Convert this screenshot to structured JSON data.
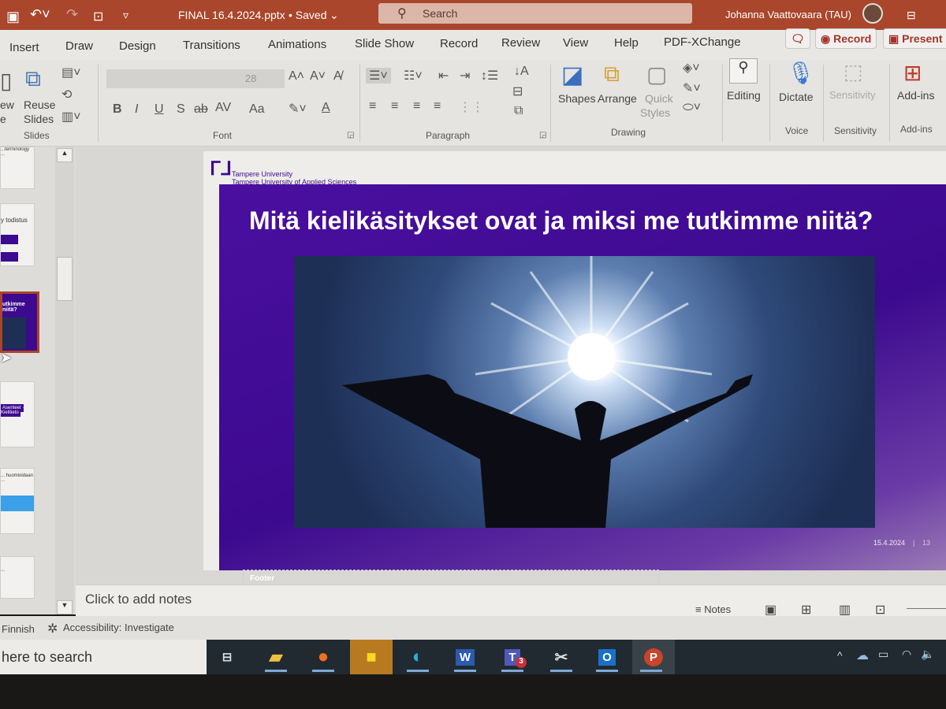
{
  "titlebar": {
    "filename": "FINAL 16.4.2024.pptx",
    "save_status": "• Saved",
    "search_placeholder": "Search",
    "user": "Johanna Vaattovaara (TAU)"
  },
  "tabs": [
    "Insert",
    "Draw",
    "Design",
    "Transitions",
    "Animations",
    "Slide Show",
    "Record",
    "Review",
    "View",
    "Help",
    "PDF-XChange"
  ],
  "tab_buttons": {
    "record": "Record",
    "present": "Present"
  },
  "ribbon": {
    "slides": {
      "new_label": "ew",
      "new_label2": "e",
      "reuse": "Reuse",
      "reuse2": "Slides",
      "group": "Slides"
    },
    "font": {
      "size": "28",
      "group": "Font",
      "bold": "B",
      "italic": "I",
      "underline": "U",
      "shadow": "S",
      "strike": "ab",
      "spacing": "AV",
      "case": "Aa",
      "color": "A"
    },
    "paragraph": {
      "group": "Paragraph"
    },
    "drawing": {
      "shapes": "Shapes",
      "arrange": "Arrange",
      "quick_styles": "Quick",
      "quick_styles2": "Styles",
      "group": "Drawing"
    },
    "editing": "Editing",
    "voice": {
      "dictate": "Dictate",
      "group": "Voice"
    },
    "sensitivity": {
      "label": "Sensitivity",
      "group": "Sensitivity"
    },
    "addins": {
      "label": "Add-ins",
      "group": "Add-ins"
    }
  },
  "thumbnails": [
    {
      "text": "...terminology ..."
    },
    {
      "text": "y todistus"
    },
    {
      "text": "utkimme niitä?",
      "selected": true
    },
    {
      "text": "Asenteet · Kielitieto"
    },
    {
      "text": "... huomioidaan ..."
    },
    {
      "text": "..."
    }
  ],
  "slide": {
    "logo_line1": "Tampere University",
    "logo_line2": "Tampere University of Applied Sciences",
    "title": "Mitä kielikäsitykset ovat ja miksi me tutkimme niitä?",
    "footer": "Footer",
    "date": "15.4.2024",
    "page_number": "13"
  },
  "notes": {
    "placeholder": "Click to add notes",
    "toggle": "Notes"
  },
  "status": {
    "language": "Finnish",
    "accessibility": "Accessibility: Investigate"
  },
  "taskbar": {
    "search": "here to search",
    "teams_badge": "3",
    "apps": [
      "task-view",
      "file-explorer",
      "firefox",
      "sticky-notes",
      "edge",
      "word",
      "teams",
      "snipping-tool",
      "outlook",
      "powerpoint"
    ]
  },
  "colors": {
    "titlebar": "#a9462b",
    "slide_purple": "#4a0fa0",
    "accent": "#a3342a"
  }
}
